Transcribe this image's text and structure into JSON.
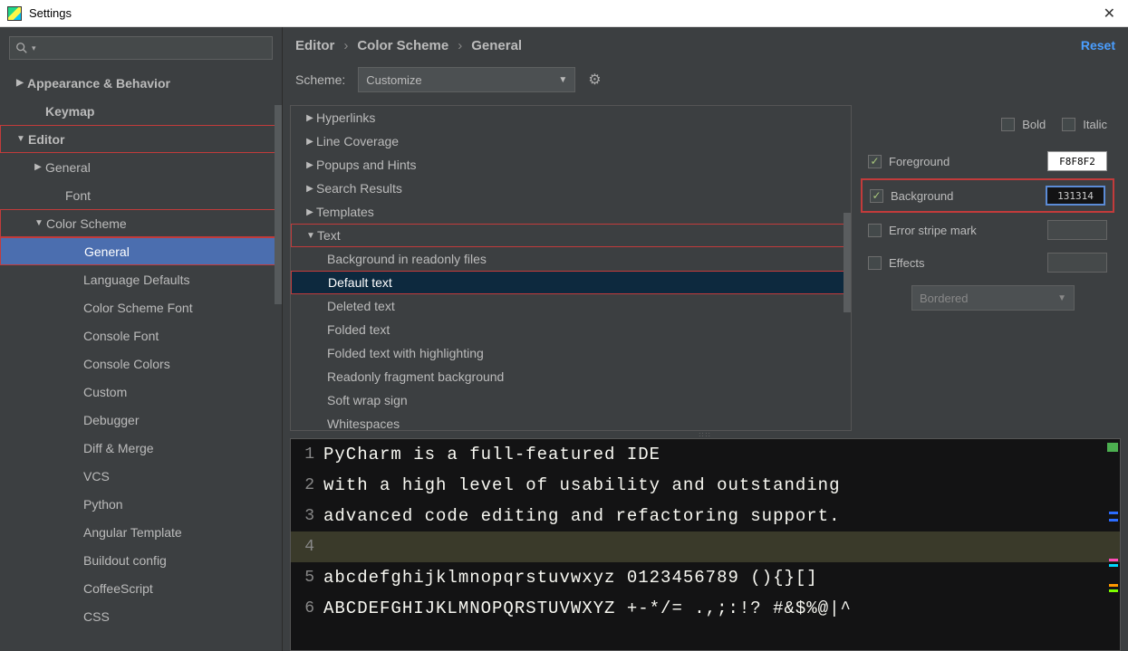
{
  "window": {
    "title": "Settings"
  },
  "sidebar": {
    "search_placeholder": "",
    "items": [
      {
        "label": "Appearance & Behavior",
        "arrow": "▶",
        "bold": true
      },
      {
        "label": "Keymap",
        "arrow": "",
        "bold": true,
        "indent": "indent-1b"
      },
      {
        "label": "Editor",
        "arrow": "▼",
        "bold": true,
        "red": true
      },
      {
        "label": "General",
        "arrow": "▶",
        "indent": "indent-1"
      },
      {
        "label": "Font",
        "arrow": "",
        "indent": "indent-2"
      },
      {
        "label": "Color Scheme",
        "arrow": "▼",
        "indent": "indent-1",
        "red": true
      },
      {
        "label": "General",
        "arrow": "",
        "indent": "indent-2b",
        "selected": true,
        "red": true
      },
      {
        "label": "Language Defaults",
        "arrow": "",
        "indent": "indent-2b"
      },
      {
        "label": "Color Scheme Font",
        "arrow": "",
        "indent": "indent-2b"
      },
      {
        "label": "Console Font",
        "arrow": "",
        "indent": "indent-2b"
      },
      {
        "label": "Console Colors",
        "arrow": "",
        "indent": "indent-2b"
      },
      {
        "label": "Custom",
        "arrow": "",
        "indent": "indent-2b"
      },
      {
        "label": "Debugger",
        "arrow": "",
        "indent": "indent-2b"
      },
      {
        "label": "Diff & Merge",
        "arrow": "",
        "indent": "indent-2b"
      },
      {
        "label": "VCS",
        "arrow": "",
        "indent": "indent-2b"
      },
      {
        "label": "Python",
        "arrow": "",
        "indent": "indent-2b"
      },
      {
        "label": "Angular Template",
        "arrow": "",
        "indent": "indent-2b"
      },
      {
        "label": "Buildout config",
        "arrow": "",
        "indent": "indent-2b"
      },
      {
        "label": "CoffeeScript",
        "arrow": "",
        "indent": "indent-2b"
      },
      {
        "label": "CSS",
        "arrow": "",
        "indent": "indent-2b"
      }
    ]
  },
  "breadcrumb": {
    "a": "Editor",
    "b": "Color Scheme",
    "c": "General",
    "reset": "Reset"
  },
  "scheme": {
    "label": "Scheme:",
    "value": "Customize"
  },
  "scheme_tree": [
    {
      "label": "Hyperlinks",
      "arrow": "▶"
    },
    {
      "label": "Line Coverage",
      "arrow": "▶"
    },
    {
      "label": "Popups and Hints",
      "arrow": "▶"
    },
    {
      "label": "Search Results",
      "arrow": "▶"
    },
    {
      "label": "Templates",
      "arrow": "▶"
    },
    {
      "label": "Text",
      "arrow": "▼",
      "red": true
    },
    {
      "label": "Background in readonly files",
      "indent": true
    },
    {
      "label": "Default text",
      "indent": true,
      "selected": true,
      "red": true
    },
    {
      "label": "Deleted text",
      "indent": true
    },
    {
      "label": "Folded text",
      "indent": true
    },
    {
      "label": "Folded text with highlighting",
      "indent": true
    },
    {
      "label": "Readonly fragment background",
      "indent": true
    },
    {
      "label": "Soft wrap sign",
      "indent": true
    },
    {
      "label": "Whitespaces",
      "indent": true
    }
  ],
  "props": {
    "bold": "Bold",
    "italic": "Italic",
    "foreground": "Foreground",
    "fg_value": "F8F8F2",
    "background": "Background",
    "bg_value": "131314",
    "error_stripe": "Error stripe mark",
    "effects": "Effects",
    "effects_type": "Bordered"
  },
  "preview": {
    "lines": [
      {
        "n": "1",
        "t": "PyCharm is a full-featured IDE"
      },
      {
        "n": "2",
        "t": "with a high level of usability and outstanding"
      },
      {
        "n": "3",
        "t": "advanced code editing and refactoring support."
      },
      {
        "n": "4",
        "t": "",
        "current": true
      },
      {
        "n": "5",
        "t": "abcdefghijklmnopqrstuvwxyz 0123456789 (){}[]"
      },
      {
        "n": "6",
        "t": "ABCDEFGHIJKLMNOPQRSTUVWXYZ +-*/= .,;:!? #&$%@|^"
      }
    ]
  }
}
